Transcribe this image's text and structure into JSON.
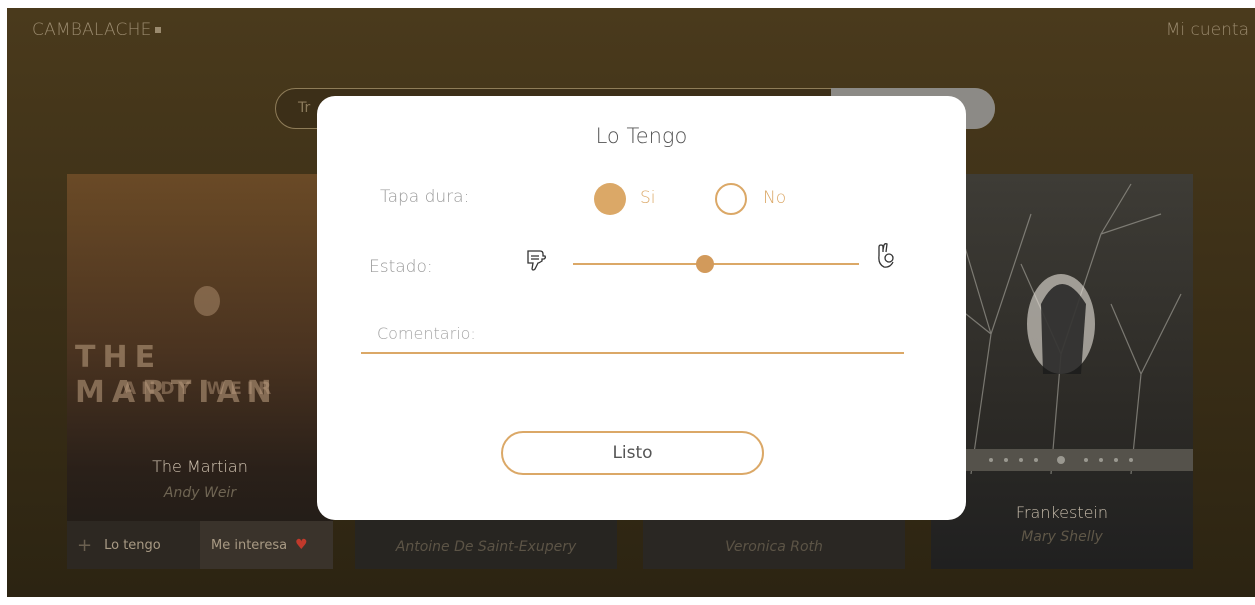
{
  "header": {
    "brand": "CAMBALACHE",
    "account": "Mi cuenta"
  },
  "search": {
    "placeholder": "Tr"
  },
  "books": [
    {
      "title": "The Martian",
      "author": "Andy Weir",
      "cover_title": "THE MARTIAN",
      "cover_author": "ANDY WEIR",
      "have_label": "Lo tengo",
      "want_label": "Me interesa"
    },
    {
      "author": "Antoine De Saint-Exupery"
    },
    {
      "author": "Veronica Roth"
    },
    {
      "title": "Frankestein",
      "author": "Mary Shelly"
    }
  ],
  "modal": {
    "title": "Lo Tengo",
    "hardcover_label": "Tapa dura:",
    "option_yes": "Si",
    "option_no": "No",
    "selected": "Si",
    "condition_label": "Estado:",
    "condition_level": 0.46,
    "comment_placeholder": "Comentario:",
    "submit_label": "Listo"
  },
  "colors": {
    "accent": "#dba867",
    "accent_dark": "#d29a5b",
    "backdrop": "#3e3118"
  },
  "icons": {
    "bad": "thumbs-down-icon",
    "good": "ok-hand-icon",
    "favorite": "heart-icon",
    "add": "plus-icon"
  }
}
